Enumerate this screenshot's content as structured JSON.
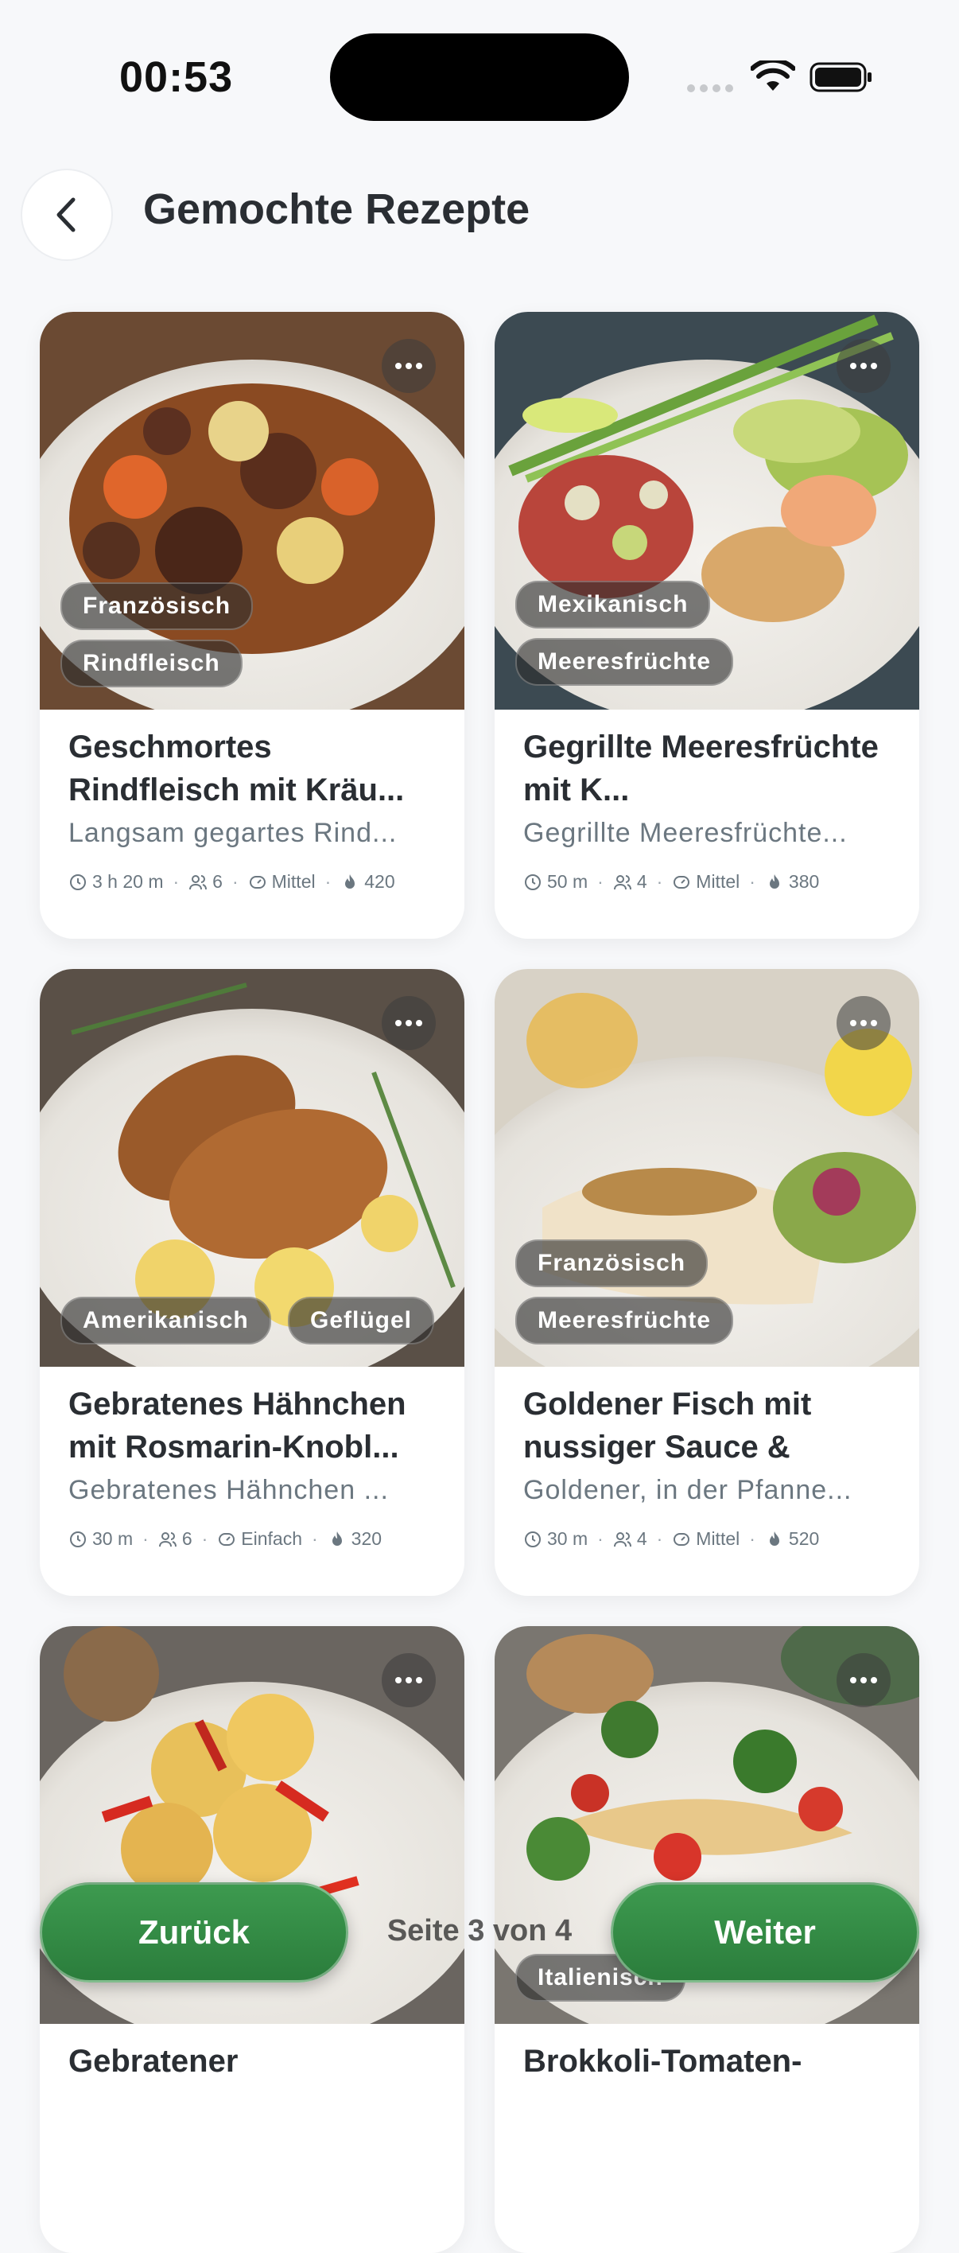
{
  "status_bar": {
    "time": "00:53"
  },
  "header": {
    "title": "Gemochte Rezepte"
  },
  "recipes": [
    {
      "tags": [
        "Französisch",
        "Rindfleisch"
      ],
      "title": "Geschmortes Rindfleisch mit Kräu...",
      "description": "Langsam gegartes Rind...",
      "time": "3 h 20 m",
      "servings": "6",
      "difficulty": "Mittel",
      "calories": "420"
    },
    {
      "tags": [
        "Mexikanisch",
        "Meeresfrüchte"
      ],
      "title": "Gegrillte Meeresfrüchte mit K...",
      "description": "Gegrillte Meeresfrüchte...",
      "time": "50 m",
      "servings": "4",
      "difficulty": "Mittel",
      "calories": "380"
    },
    {
      "tags": [
        "Amerikanisch",
        "Geflügel"
      ],
      "title": "Gebratenes Hähnchen mit Rosmarin-Knobl...",
      "description": "Gebratenes Hähnchen ...",
      "time": "30 m",
      "servings": "6",
      "difficulty": "Einfach",
      "calories": "320"
    },
    {
      "tags": [
        "Französisch",
        "Meeresfrüchte"
      ],
      "title": "Goldener Fisch mit nussiger Sauce &",
      "description": "Goldener, in der Pfanne...",
      "time": "30 m",
      "servings": "4",
      "difficulty": "Mittel",
      "calories": "520"
    },
    {
      "tags": [],
      "title": "Gebratener",
      "description": "",
      "time": "",
      "servings": "",
      "difficulty": "",
      "calories": ""
    },
    {
      "tags": [
        "Italienisch"
      ],
      "title": "Brokkoli-Tomaten-",
      "description": "",
      "time": "",
      "servings": "",
      "difficulty": "",
      "calories": ""
    }
  ],
  "pagination": {
    "prev_label": "Zurück",
    "next_label": "Weiter",
    "indicator": "Seite 3 von 4"
  },
  "colors": {
    "accent_green": "#2f8a43",
    "background": "#f7f8fa"
  }
}
